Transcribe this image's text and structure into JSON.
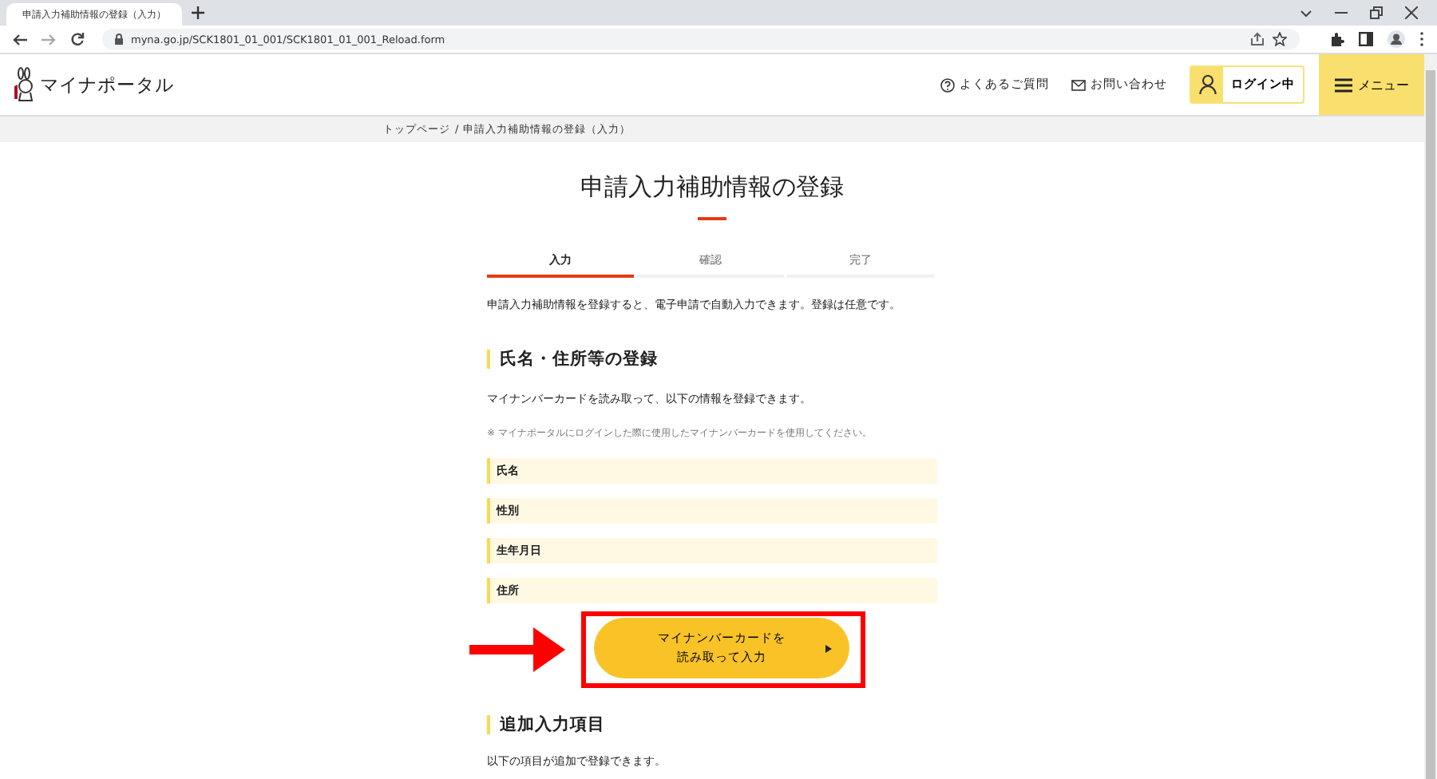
{
  "browser": {
    "tab_title": "申請入力補助情報の登録（入力）",
    "url": "myna.go.jp/SCK1801_01_001/SCK1801_01_001_Reload.form"
  },
  "header": {
    "logo_text": "マイナポータル",
    "links": [
      {
        "label": "よくあるご質問",
        "kind": "help"
      },
      {
        "label": "お問い合わせ",
        "kind": "mail"
      }
    ],
    "login": "ログイン中",
    "menu": "メニュー"
  },
  "breadcrumb": {
    "items": [
      "トップページ",
      "申請入力補助情報の登録（入力）"
    ],
    "separator": "/"
  },
  "title": "申請入力補助情報の登録",
  "steps": [
    {
      "label": "入力",
      "selected": true
    },
    {
      "label": "確認",
      "selected": false
    },
    {
      "label": "完了",
      "selected": false
    }
  ],
  "intro": "申請入力補助情報を登録すると、電子申請で自動入力できます。登録は任意です。",
  "section_1": {
    "heading": "氏名・住所等の登録",
    "description": "マイナンバーカードを読み取って、以下の情報を登録できます。",
    "note": "※ マイナポータルにログインした際に使用したマイナンバーカードを使用してください。",
    "fields": [
      "氏名",
      "性別",
      "生年月日",
      "住所"
    ],
    "button_lines": [
      "マイナンバーカードを",
      "読み取って入力"
    ]
  },
  "section_2": {
    "heading": "追加入力項目",
    "description": "以下の項目が追加で登録できます。"
  }
}
